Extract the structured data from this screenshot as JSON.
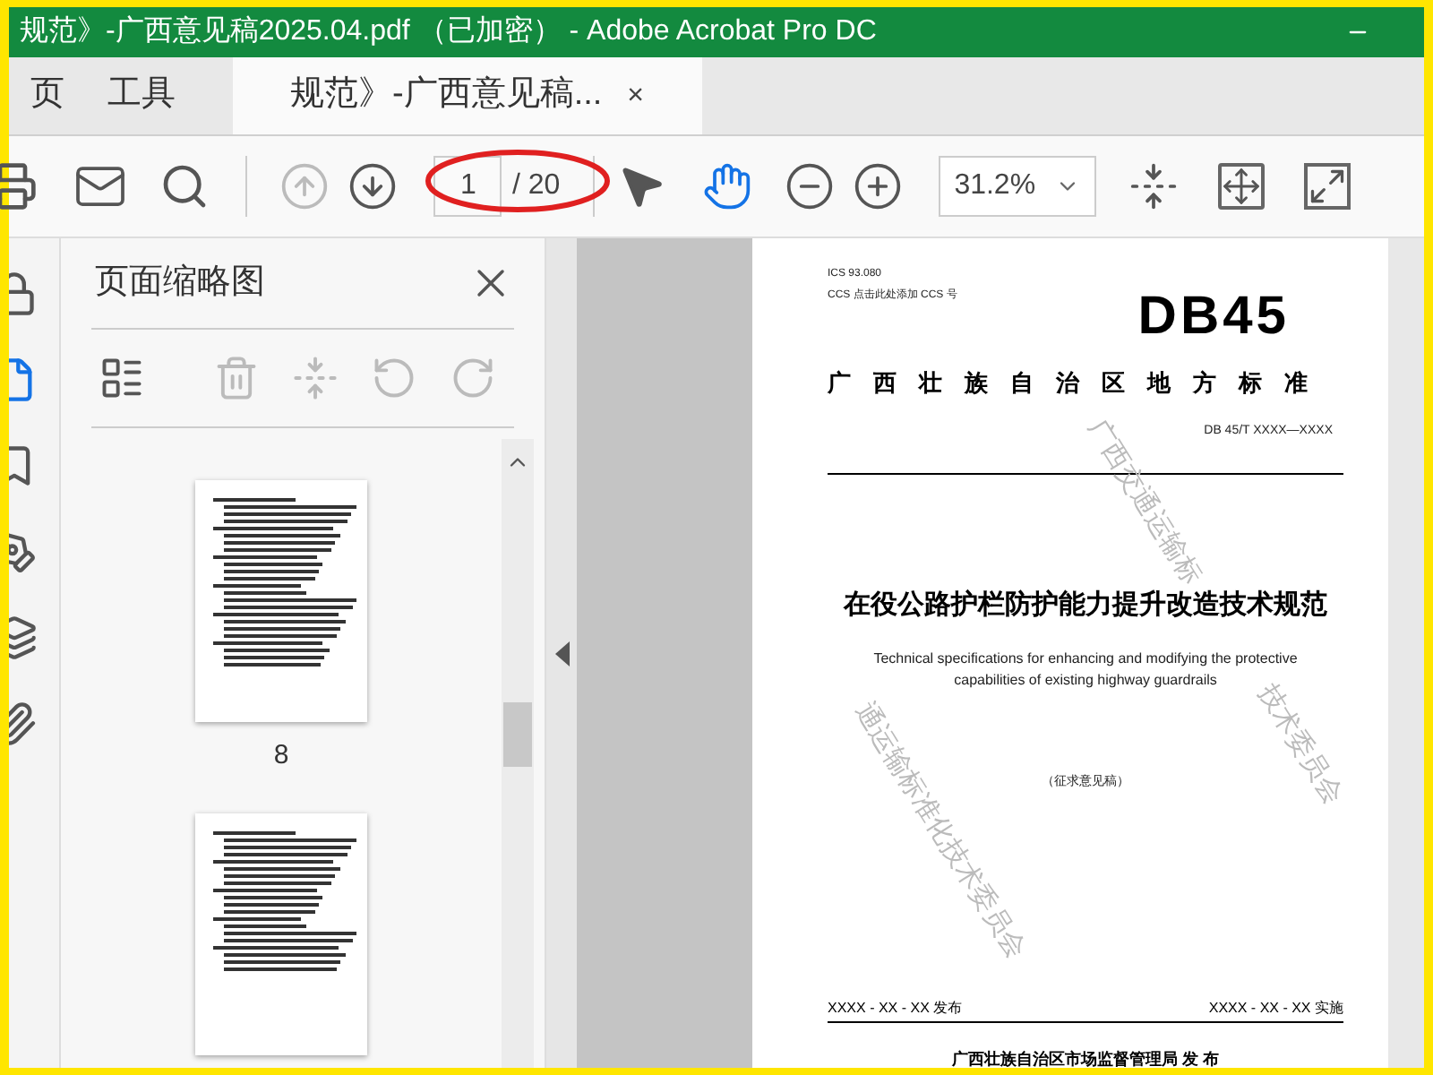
{
  "window": {
    "title": "规范》-广西意见稿2025.04.pdf （已加密） - Adobe Acrobat Pro DC"
  },
  "tabs": [
    {
      "label": "页",
      "selected": false,
      "closable": false
    },
    {
      "label": "工具",
      "selected": false,
      "closable": false
    },
    {
      "label": "规范》-广西意见稿...",
      "selected": true,
      "closable": true,
      "close": "×"
    }
  ],
  "toolbar": {
    "nav": [
      {
        "kind": "up",
        "disabled": true
      },
      {
        "kind": "down",
        "disabled": false
      }
    ],
    "page_number": {
      "value": "1"
    },
    "page_count": "/ 20",
    "tools": [
      {
        "kind": "select",
        "selected": false
      },
      {
        "kind": "hand",
        "selected": true
      }
    ],
    "zoom": {
      "value": "31.2%"
    }
  },
  "annotation": {
    "kind": "ellipse",
    "color": "#e02020"
  },
  "side_rail": [
    {
      "kind": "lock",
      "selected": false
    },
    {
      "kind": "thumbnails",
      "selected": true
    },
    {
      "kind": "bookmark",
      "selected": false
    },
    {
      "kind": "signature",
      "selected": false
    },
    {
      "kind": "layers",
      "selected": false
    },
    {
      "kind": "attachment",
      "selected": false
    }
  ],
  "panel": {
    "title": "页面缩略图",
    "tools": [
      {
        "kind": "options",
        "disabled": false
      },
      {
        "kind": "delete",
        "disabled": true
      },
      {
        "kind": "insert",
        "disabled": true
      },
      {
        "kind": "rotate_ccw",
        "disabled": true
      },
      {
        "kind": "rotate_cw",
        "disabled": true
      }
    ],
    "thumbnails": [
      {
        "label": "8",
        "selected": false
      },
      {
        "selected": false
      }
    ]
  },
  "document": {
    "ics": "ICS  93.080",
    "ccs": "CCS  点击此处添加 CCS 号",
    "logo": "DB45",
    "authority": "广西壮族自治区地方标准",
    "code": "DB 45/T  XXXX—XXXX",
    "title_cn": "在役公路护栏防护能力提升改造技术规范",
    "title_en": "Technical specifications for enhancing and modifying the protective capabilities of existing highway guardrails",
    "draft": "（征求意见稿）",
    "issue_date": "XXXX - XX - XX 发布",
    "implement_date": "XXXX - XX - XX 实施",
    "publisher": "广西壮族自治区市场监督管理局    发 布",
    "watermarks": [
      "广西交通运输标",
      "技术委员会",
      "通运输标准化技术委员会"
    ]
  }
}
